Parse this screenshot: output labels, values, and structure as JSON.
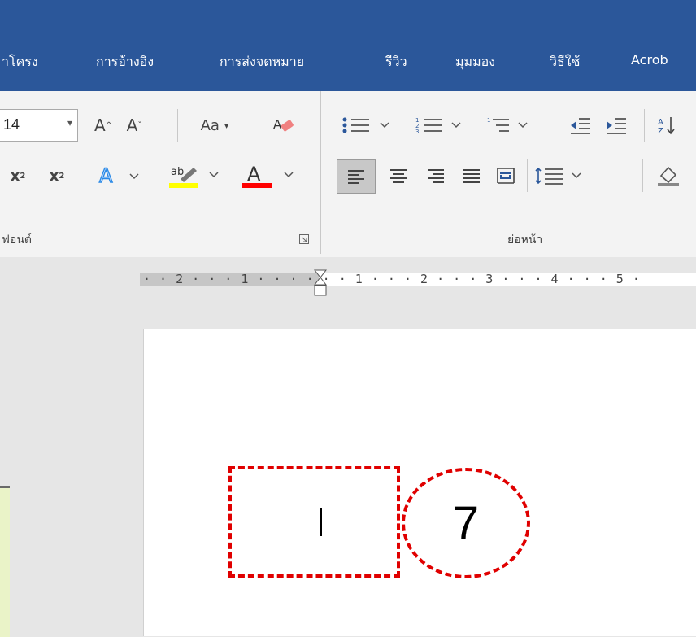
{
  "tabs": [
    "าโครง",
    "การอ้างอิง",
    "การส่งจดหมาย",
    "รีวิว",
    "มุมมอง",
    "วิธีใช้",
    "Acrob"
  ],
  "ribbon": {
    "font_size": "14",
    "font_group_label": "ฟอนต์",
    "paragraph_group_label": "ย่อหน้า",
    "change_case_label": "Aa"
  },
  "ruler": {
    "ticks": "· · 2 · · · 1 · · ·   · · · 1 · · · 2 · · · 3 · · · 4 · · · 5 ·"
  },
  "annotation": {
    "step_number": "7",
    "color": "#e00000"
  },
  "colors": {
    "ribbon_blue": "#2b579a",
    "highlight_yellow": "#ffff00",
    "font_color_red": "#ff0000"
  }
}
